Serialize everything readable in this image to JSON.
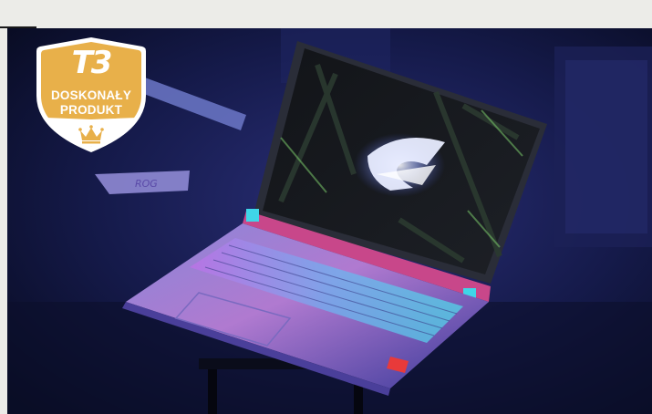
{
  "badge": {
    "brand": "T3",
    "line1": "DOSKONAŁY",
    "line2": "PRODUKT",
    "icon": "crown-icon",
    "color": "#e8b04a"
  },
  "photo": {
    "subject": "gaming-laptop",
    "logo_text": "ROG",
    "accent_colors": [
      "#5a3df0",
      "#e5409a",
      "#3fd6e8",
      "#e83a3a"
    ]
  }
}
